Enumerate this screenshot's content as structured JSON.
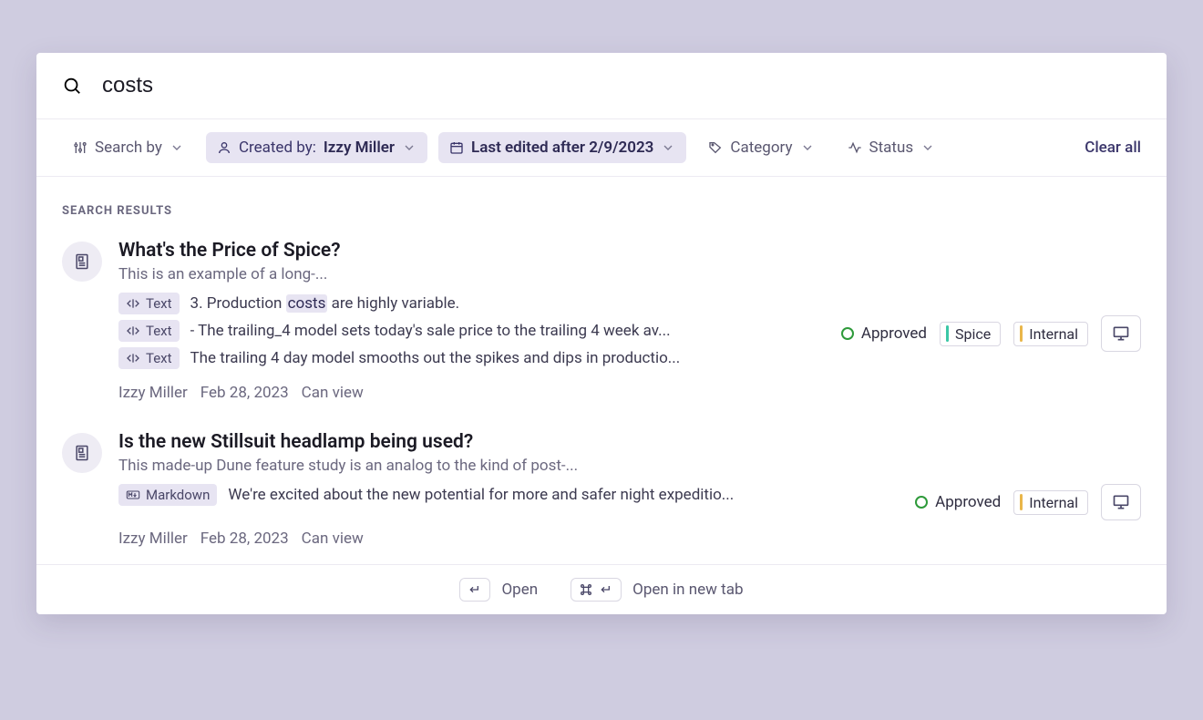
{
  "search": {
    "value": "costs",
    "highlight": "costs"
  },
  "filters": {
    "search_by_label": "Search by",
    "created_by_label": "Created by:",
    "created_by_value": "Izzy Miller",
    "last_edited_label": "Last edited after 2/9/2023",
    "category_label": "Category",
    "status_label": "Status",
    "clear_label": "Clear all"
  },
  "results_heading": "SEARCH RESULTS",
  "results": [
    {
      "title": "What's the Price of Spice?",
      "subtitle": "This is an example of a long-...",
      "snippets": [
        {
          "badge": "Text",
          "pre": "3. Production ",
          "hl": "costs",
          "post": " are highly variable."
        },
        {
          "badge": "Text",
          "text": "- The trailing_4 model sets today's sale price to the trailing 4 week av..."
        },
        {
          "badge": "Text",
          "text": "The trailing 4 day model smooths out the spikes and dips in productio..."
        }
      ],
      "author": "Izzy Miller",
      "date": "Feb 28, 2023",
      "perm": "Can view",
      "status": "Approved",
      "tags": [
        {
          "color": "teal",
          "label": "Spice"
        },
        {
          "color": "amber",
          "label": "Internal"
        }
      ]
    },
    {
      "title": "Is the new Stillsuit headlamp being used?",
      "subtitle": "This made-up Dune feature study is an analog to the kind of post-...",
      "snippets": [
        {
          "badge": "Markdown",
          "text": "We're excited about the new potential for more and safer night expeditio..."
        }
      ],
      "author": "Izzy Miller",
      "date": "Feb 28, 2023",
      "perm": "Can view",
      "status": "Approved",
      "tags": [
        {
          "color": "amber",
          "label": "Internal"
        }
      ]
    }
  ],
  "footer": {
    "open": "Open",
    "open_new_tab": "Open in new tab"
  }
}
